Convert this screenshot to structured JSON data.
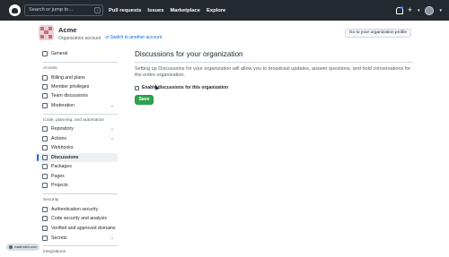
{
  "header": {
    "search_placeholder": "Search or jump to…",
    "search_key": "/",
    "nav": [
      "Pull requests",
      "Issues",
      "Marketplace",
      "Explore"
    ],
    "icons": [
      "github-logo-icon",
      "bell-icon",
      "plus-icon",
      "avatar"
    ]
  },
  "org": {
    "name": "Acme",
    "subtitle": "Organization account",
    "switch_label": "Switch to another account",
    "profile_button": "Go to your organization profile"
  },
  "sidebar": {
    "general": "General",
    "sections": [
      {
        "heading": "Access",
        "items": [
          "Billing and plans",
          "Member privileges",
          "Team discussions",
          "Moderation"
        ]
      },
      {
        "heading": "Code, planning, and automation",
        "items": [
          "Repository",
          "Actions",
          "Webhooks",
          "Discussions",
          "Packages",
          "Pages",
          "Projects"
        ]
      },
      {
        "heading": "Security",
        "items": [
          "Authentication security",
          "Code security and analysis",
          "Verified and approved domains",
          "Secrets"
        ]
      },
      {
        "heading": "Integrations",
        "items": []
      }
    ],
    "selected": "Discussions"
  },
  "main": {
    "title": "Discussions for your organization",
    "description": "Setting up Discussions for your organization will allow you to broadcast updates, answer questions, and hold conversations for the entire organization.",
    "enable_label": "Enable discussions for this organization",
    "save_label": "Save"
  },
  "badge": {
    "label": "made with Loom"
  },
  "colors": {
    "header_bg": "#24292f",
    "save_green": "#2da44e",
    "link_blue": "#0969da",
    "selected_indicator": "#0969da"
  }
}
